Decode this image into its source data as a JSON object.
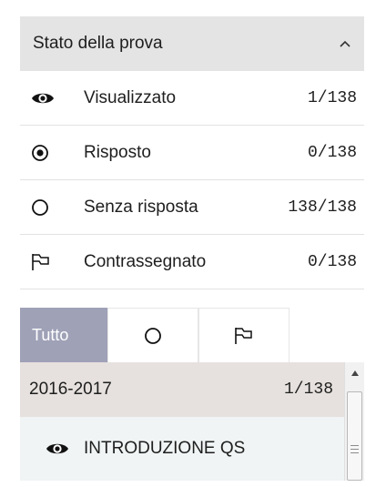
{
  "header": {
    "title": "Stato della prova",
    "toggle_icon": "chevron-up-icon"
  },
  "status_items": [
    {
      "icon": "eye-icon",
      "label": "Visualizzato",
      "count": "1/138"
    },
    {
      "icon": "radio-checked-icon",
      "label": "Risposto",
      "count": "0/138"
    },
    {
      "icon": "radio-empty-icon",
      "label": "Senza risposta",
      "count": "138/138"
    },
    {
      "icon": "flag-icon",
      "label": "Contrassegnato",
      "count": "0/138"
    }
  ],
  "tabs": [
    {
      "label": "Tutto",
      "active": true
    },
    {
      "icon": "radio-empty-icon",
      "active": false
    },
    {
      "icon": "flag-icon",
      "active": false
    }
  ],
  "tree": {
    "group": {
      "label": "2016-2017",
      "count": "1/138"
    },
    "items": [
      {
        "icon": "eye-icon",
        "label": "INTRODUZIONE QS"
      }
    ]
  },
  "colors": {
    "header_bg": "#e4e4e4",
    "tab_active_bg": "#9fa1b7",
    "group_bg": "#e6e1de",
    "item_bg": "#f0f4f4"
  }
}
